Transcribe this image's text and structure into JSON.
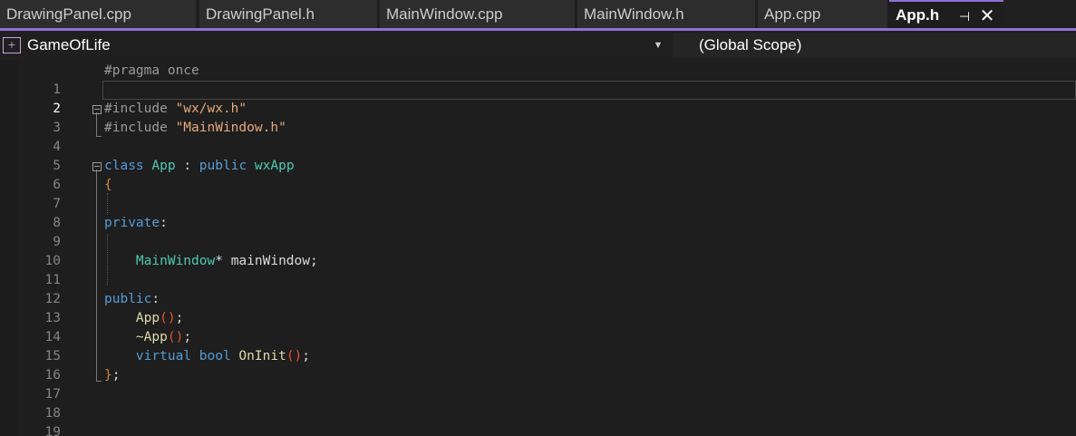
{
  "tabs": [
    {
      "label": "DrawingPanel.cpp"
    },
    {
      "label": "DrawingPanel.h"
    },
    {
      "label": "MainWindow.cpp"
    },
    {
      "label": "MainWindow.h"
    },
    {
      "label": "App.cpp"
    },
    {
      "label": "App.h",
      "active": true
    }
  ],
  "tab_icons": {
    "pin": "pin-icon",
    "close": "close-icon"
  },
  "navbar": {
    "project": "GameOfLife",
    "project_icon": "cpp-project-icon",
    "dropdown_icon": "chevron-down-icon",
    "scope": "(Global Scope)"
  },
  "colors": {
    "accent": "#8e70d9",
    "keyword": "#569cd6",
    "type": "#4ec9b0",
    "function": "#dcdcaa",
    "string": "#e8a87c",
    "preprocessor": "#9b9b9b"
  },
  "editor": {
    "current_line": 2,
    "line_numbers": [
      "1",
      "2",
      "3",
      "4",
      "5",
      "6",
      "7",
      "8",
      "9",
      "10",
      "11",
      "12",
      "13",
      "14",
      "15",
      "16",
      "17",
      "18",
      "19"
    ],
    "lines": {
      "l1": {
        "a": "#pragma once"
      },
      "l3": {
        "a": "#include ",
        "b": "\"wx/wx.h\""
      },
      "l4": {
        "a": "#include ",
        "b": "\"MainWindow.h\""
      },
      "l6": {
        "a": "class",
        "b": " ",
        "c": "App",
        "d": " : ",
        "e": "public",
        "f": " ",
        "g": "wxApp"
      },
      "l7": {
        "a": "{"
      },
      "l9": {
        "a": "private",
        "b": ":"
      },
      "l11": {
        "a": "    ",
        "b": "MainWindow",
        "c": "* mainWindow;"
      },
      "l13": {
        "a": "public",
        "b": ":"
      },
      "l14": {
        "a": "    ",
        "b": "App",
        "c": "()",
        "d": ";"
      },
      "l15": {
        "a": "    ~",
        "b": "App",
        "c": "()",
        "d": ";"
      },
      "l16": {
        "a": "    ",
        "b": "virtual",
        "c": " ",
        "d": "bool",
        "e": " ",
        "f": "OnInit",
        "g": "()",
        "h": ";"
      },
      "l17": {
        "a": "}",
        "b": ";"
      }
    }
  }
}
